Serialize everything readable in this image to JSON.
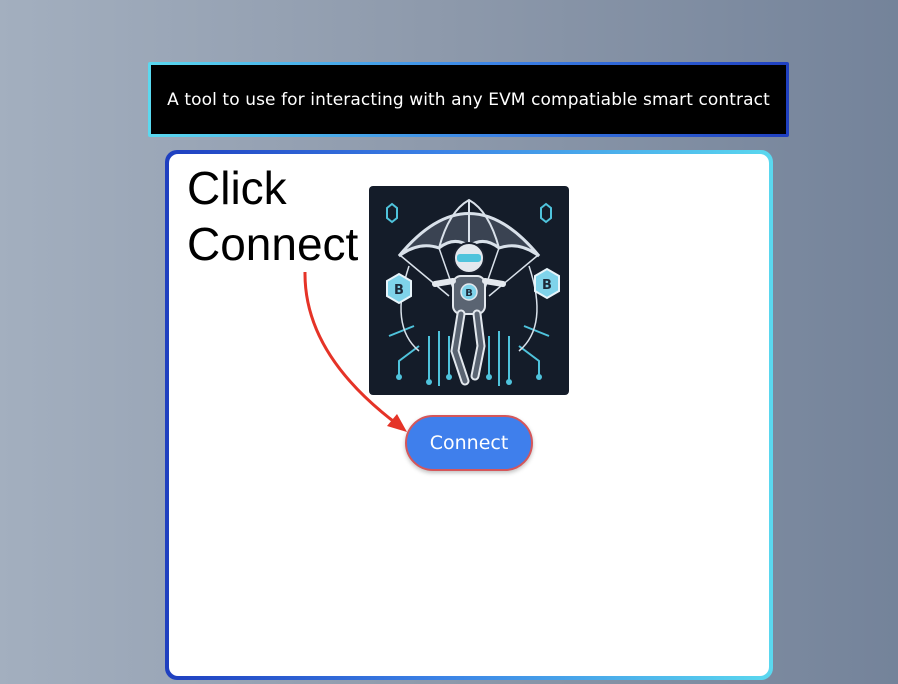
{
  "banner": {
    "text": "A tool to use for interacting with any EVM compatiable smart contract"
  },
  "card": {
    "instruction_line1": "Click",
    "instruction_line2": "Connect",
    "connect_label": "Connect",
    "logo_icon": "astronaut-parachute-logo",
    "logo_letter": "B"
  },
  "colors": {
    "button": "#3f7fec",
    "button_border": "#d5565a",
    "arrow": "#e53327",
    "card_border_start": "#1f3fc0",
    "card_border_end": "#5ad8ef",
    "banner_bg": "#000000"
  }
}
